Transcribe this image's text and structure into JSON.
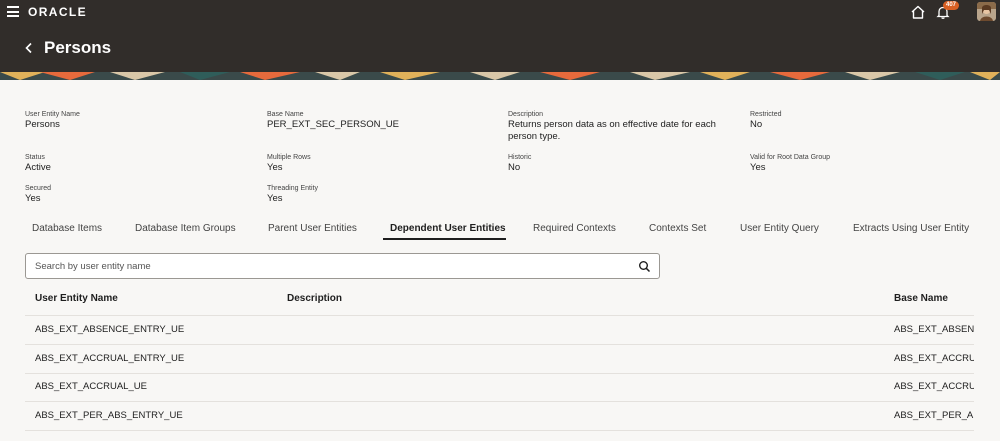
{
  "topbar": {
    "logo": "ORACLE",
    "notification_count": "407"
  },
  "header": {
    "title": "Persons"
  },
  "details": {
    "user_entity_name": {
      "label": "User Entity Name",
      "value": "Persons"
    },
    "base_name": {
      "label": "Base Name",
      "value": "PER_EXT_SEC_PERSON_UE"
    },
    "description": {
      "label": "Description",
      "value_line1": "Returns person data as on effective date for each",
      "value_line2": "person type."
    },
    "restricted": {
      "label": "Restricted",
      "value": "No"
    },
    "status": {
      "label": "Status",
      "value": "Active"
    },
    "multiple_rows": {
      "label": "Multiple Rows",
      "value": "Yes"
    },
    "historic": {
      "label": "Historic",
      "value": "No"
    },
    "valid_root": {
      "label": "Valid for Root Data Group",
      "value": "Yes"
    },
    "secured": {
      "label": "Secured",
      "value": "Yes"
    },
    "threading_entity": {
      "label": "Threading Entity",
      "value": "Yes"
    }
  },
  "tabs": [
    {
      "label": "Database Items"
    },
    {
      "label": "Database Item Groups"
    },
    {
      "label": "Parent User Entities"
    },
    {
      "label": "Dependent User Entities"
    },
    {
      "label": "Required Contexts"
    },
    {
      "label": "Contexts Set"
    },
    {
      "label": "User Entity Query"
    },
    {
      "label": "Extracts Using User Entity"
    }
  ],
  "active_tab": "Dependent User Entities",
  "search": {
    "placeholder": "Search by user entity name",
    "value": ""
  },
  "table": {
    "columns": [
      "User Entity Name",
      "Description",
      "Base Name"
    ],
    "rows": [
      {
        "name": "ABS_EXT_ABSENCE_ENTRY_UE",
        "description": "",
        "base": "ABS_EXT_ABSENC"
      },
      {
        "name": "ABS_EXT_ACCRUAL_ENTRY_UE",
        "description": "",
        "base": "ABS_EXT_ACCRUA"
      },
      {
        "name": "ABS_EXT_ACCRUAL_UE",
        "description": "",
        "base": "ABS_EXT_ACCRUA"
      },
      {
        "name": "ABS_EXT_PER_ABS_ENTRY_UE",
        "description": "",
        "base": "ABS_EXT_PER_ABS"
      }
    ]
  },
  "colors": {
    "topbar_bg": "#312d2a",
    "badge": "#d86024",
    "page_bg": "#f8f7f5",
    "text": "#1e1e1e"
  }
}
